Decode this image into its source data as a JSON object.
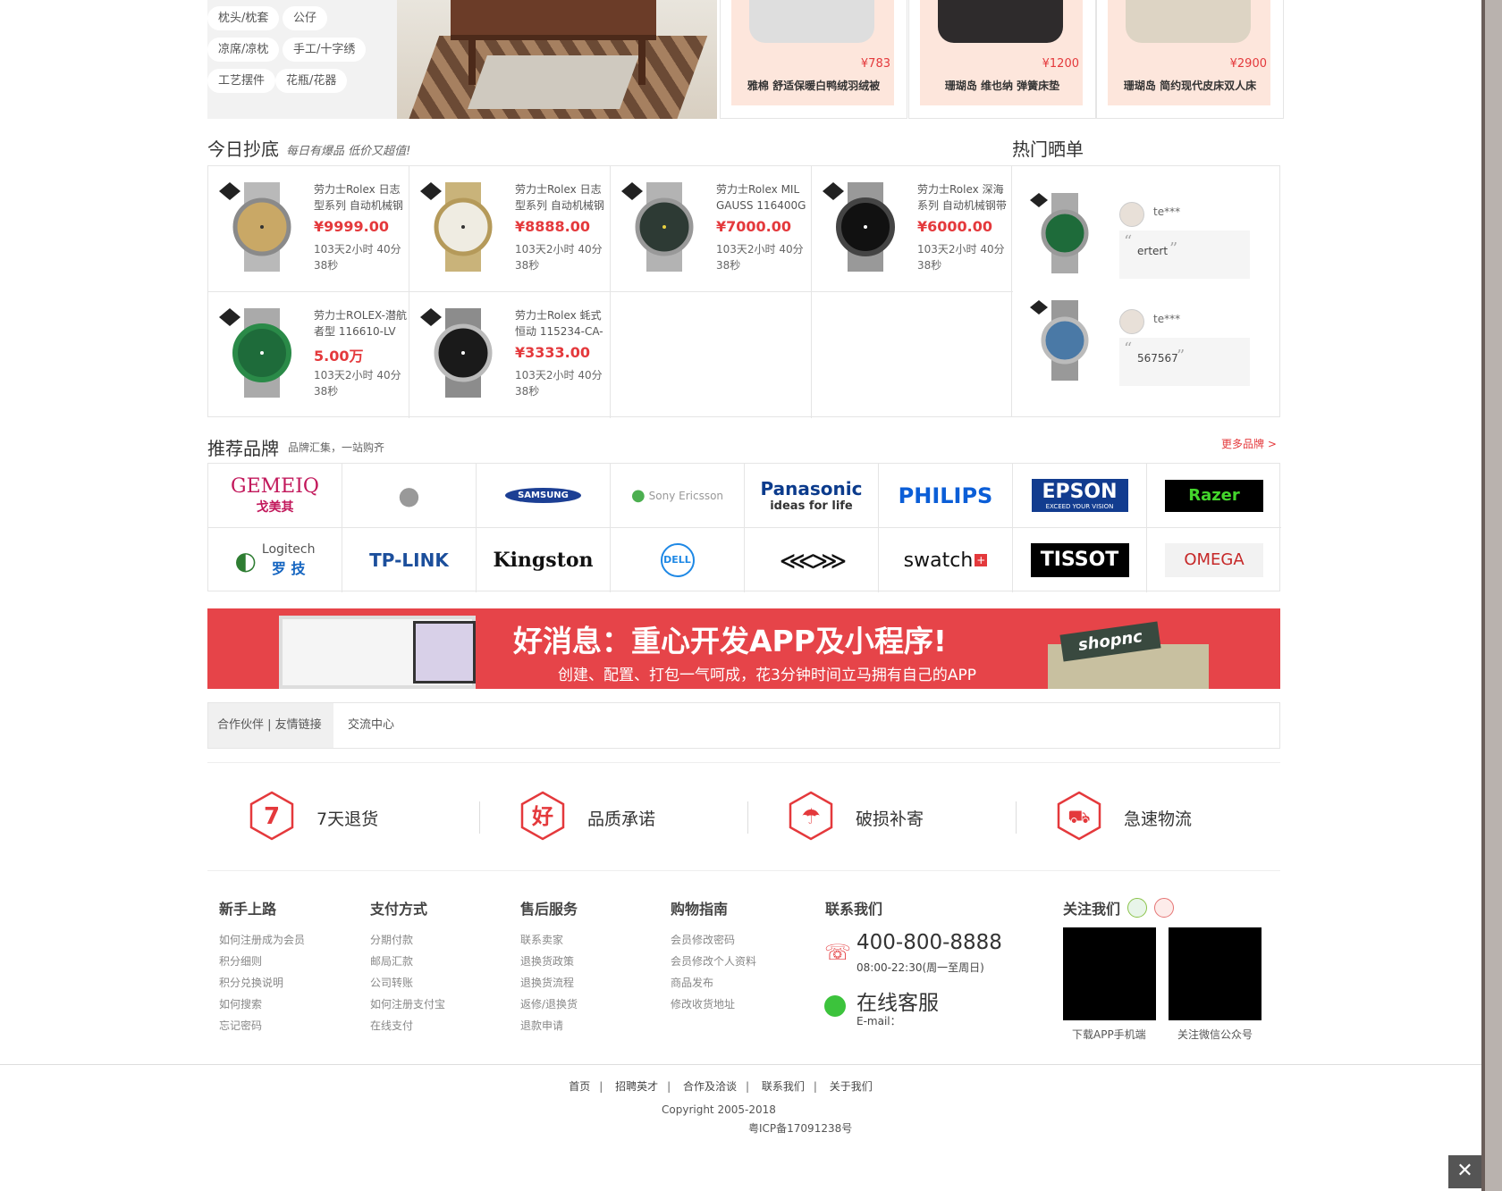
{
  "top_categories": [
    "枕头/枕套",
    "公仔",
    "凉席/凉枕",
    "手工/十字绣",
    "工艺摆件",
    "花瓶/花器"
  ],
  "top_products": [
    {
      "price": "¥783",
      "name": "雅棉 舒适保暖白鸭绒羽绒被"
    },
    {
      "price": "¥1200",
      "name": "珊瑚岛 维也纳 弹簧床垫"
    },
    {
      "price": "¥2900",
      "name": "珊瑚岛 简约现代皮床双人床"
    }
  ],
  "deals_section": {
    "title": "今日抄底",
    "subtitle": "每日有爆品 低价又超值!"
  },
  "deals": [
    {
      "name": "劳力士Rolex 日志型系列 自动机械钢",
      "price": "¥9999.00",
      "time": "103天2小时 40分38秒"
    },
    {
      "name": "劳力士Rolex 日志型系列 自动机械钢",
      "price": "¥8888.00",
      "time": "103天2小时 40分38秒"
    },
    {
      "name": "劳力士Rolex MIL GAUSS 116400G",
      "price": "¥7000.00",
      "time": "103天2小时 40分38秒"
    },
    {
      "name": "劳力士Rolex 深海系列 自动机械钢带",
      "price": "¥6000.00",
      "time": "103天2小时 40分38秒"
    },
    {
      "name": "劳力士ROLEX-潜航者型 116610-LV",
      "price": "5.00万",
      "time": "103天2小时 40分38秒"
    },
    {
      "name": "劳力士Rolex 蚝式恒动 115234-CA-",
      "price": "¥3333.00",
      "time": "103天2小时 40分38秒"
    }
  ],
  "hot_section": {
    "title": "热门晒单"
  },
  "reviews": [
    {
      "user": "te***",
      "text": "ertert"
    },
    {
      "user": "te***",
      "text": "567567"
    }
  ],
  "brands_section": {
    "title": "推荐品牌",
    "subtitle": "品牌汇集，一站购齐",
    "more": "更多品牌 >"
  },
  "brands": [
    {
      "name": "GEMEIQ",
      "sub": "戈美其"
    },
    {
      "name": "Apple",
      "sub": ""
    },
    {
      "name": "SAMSUNG",
      "sub": ""
    },
    {
      "name": "Sony Ericsson",
      "sub": ""
    },
    {
      "name": "Panasonic",
      "sub": "ideas for life"
    },
    {
      "name": "PHILIPS",
      "sub": ""
    },
    {
      "name": "EPSON",
      "sub": "EXCEED YOUR VISION"
    },
    {
      "name": "Razer",
      "sub": ""
    },
    {
      "name": "Logitech",
      "sub": "罗 技"
    },
    {
      "name": "TP-LINK",
      "sub": ""
    },
    {
      "name": "Kingston",
      "sub": ""
    },
    {
      "name": "DELL",
      "sub": ""
    },
    {
      "name": "Emporio Armani",
      "sub": ""
    },
    {
      "name": "swatch",
      "sub": ""
    },
    {
      "name": "TISSOT",
      "sub": ""
    },
    {
      "name": "OMEGA",
      "sub": ""
    }
  ],
  "ad": {
    "title": "好消息：重心开发APP及小程序!",
    "subtitle": "创建、配置、打包一气呵成，花3分钟时间立马拥有自己的APP",
    "brand": "shopnc"
  },
  "partners": {
    "tab_a": "合作伙伴 | 友情链接",
    "tab_b": "交流中心"
  },
  "services": [
    {
      "icon_char": "7",
      "label": "7天退货"
    },
    {
      "icon_char": "好",
      "label": "品质承诺"
    },
    {
      "icon_char": "☂",
      "label": "破损补寄"
    },
    {
      "icon_char": "⛟",
      "label": "急速物流"
    }
  ],
  "footer_cols": [
    {
      "title": "新手上路",
      "links": [
        "如何注册成为会员",
        "积分细则",
        "积分兑换说明",
        "如何搜索",
        "忘记密码"
      ]
    },
    {
      "title": "支付方式",
      "links": [
        "分期付款",
        "邮局汇款",
        "公司转账",
        "如何注册支付宝",
        "在线支付"
      ]
    },
    {
      "title": "售后服务",
      "links": [
        "联系卖家",
        "退换货政策",
        "退换货流程",
        "返修/退换货",
        "退款申请"
      ]
    },
    {
      "title": "购物指南",
      "links": [
        "会员修改密码",
        "会员修改个人资料",
        "商品发布",
        "修改收货地址"
      ]
    }
  ],
  "contact": {
    "title": "联系我们",
    "phone": "400-800-8888",
    "hours": "08:00-22:30(周一至周日)",
    "service": "在线客服",
    "email": "E-mail："
  },
  "follow": {
    "title": "关注我们",
    "qr1": "下载APP手机端",
    "qr2": "关注微信公众号"
  },
  "bottom_nav": [
    "首页",
    "招聘英才",
    "合作及洽谈",
    "联系我们",
    "关于我们"
  ],
  "copyright": "Copyright 2005-2018",
  "icp": "粤ICP备17091238号",
  "colors": {
    "accent": "#e4393c",
    "ad_bg": "#e64449"
  }
}
